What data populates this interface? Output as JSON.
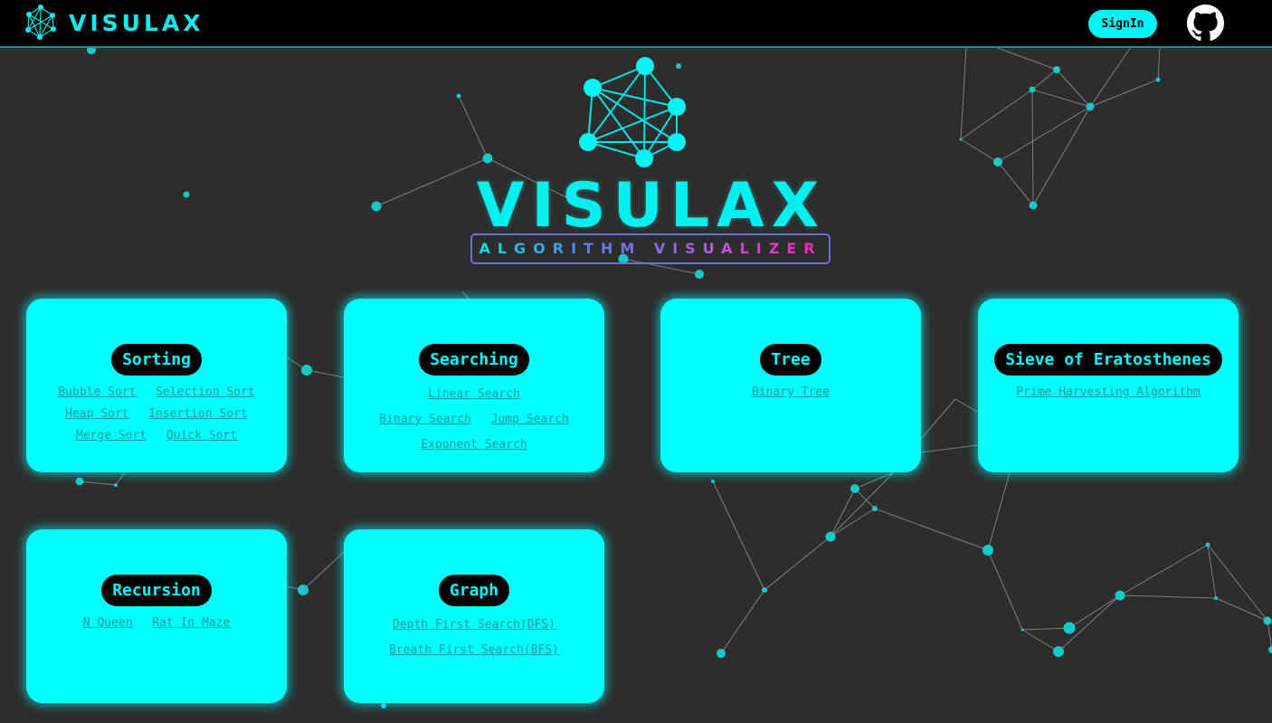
{
  "nav": {
    "brand": "VISULAX",
    "signin_label": "SignIn"
  },
  "hero": {
    "title": "VISULAX",
    "subtitle": "ALGORITHM VISUALIZER"
  },
  "cards": [
    {
      "title": "Sorting",
      "links": [
        "Bubble Sort",
        "Selection Sort",
        "Heap Sort",
        "Insertion Sort",
        "Merge Sort",
        "Quick Sort"
      ]
    },
    {
      "title": "Searching",
      "links": [
        "Linear Search",
        "Binary Search",
        "Jump Search",
        "Exponent Search"
      ]
    },
    {
      "title": "Tree",
      "links": [
        "Binary Tree"
      ]
    },
    {
      "title": "Sieve of Eratosthenes",
      "links": [
        "Prime Harvesting Algorithm"
      ]
    },
    {
      "title": "Recursion",
      "links": [
        "N Queen",
        "Rat In Maze"
      ]
    },
    {
      "title": "Graph",
      "links": [
        "Depth First Search(DFS)",
        "Breath First Search(BFS)"
      ]
    }
  ],
  "colors": {
    "accent": "#00ffff",
    "background": "#2d2d2d",
    "navbar": "#000000",
    "link": "#1a9b9b"
  },
  "icons": {
    "brand": "network-logo-icon",
    "github": "github-icon"
  }
}
